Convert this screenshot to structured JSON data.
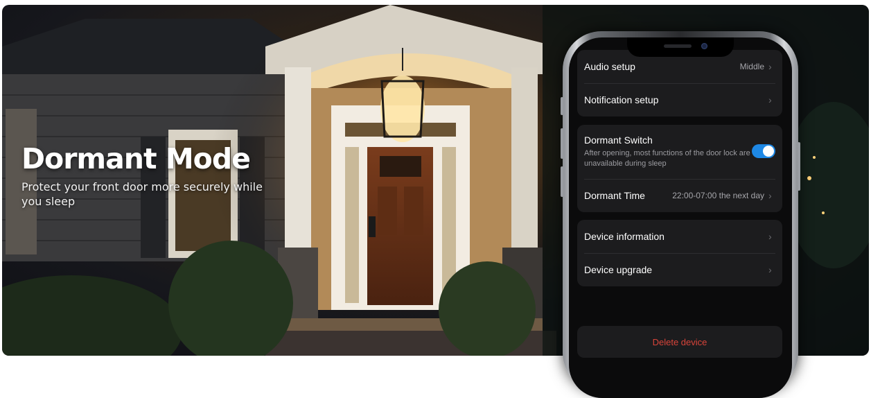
{
  "hero": {
    "title": "Dormant Mode",
    "subtitle": "Protect your front door more securely while you sleep"
  },
  "phone": {
    "settings": {
      "audio_setup": {
        "label": "Audio setup",
        "value": "Middle"
      },
      "notification_setup": {
        "label": "Notification setup"
      },
      "dormant_switch": {
        "label": "Dormant Switch",
        "description": "After opening, most functions of the door lock are unavailable during sleep",
        "enabled": true
      },
      "dormant_time": {
        "label": "Dormant Time",
        "value": "22:00-07:00 the next day"
      },
      "device_information": {
        "label": "Device information"
      },
      "device_upgrade": {
        "label": "Device upgrade"
      },
      "delete_device": {
        "label": "Delete device"
      }
    }
  },
  "icons": {
    "chevron": "chevron-right-icon",
    "camera": "front-camera-icon"
  },
  "colors": {
    "toggle_on": "#1e88e5",
    "delete_text": "#d9443a",
    "card_bg": "#1c1c1e"
  }
}
